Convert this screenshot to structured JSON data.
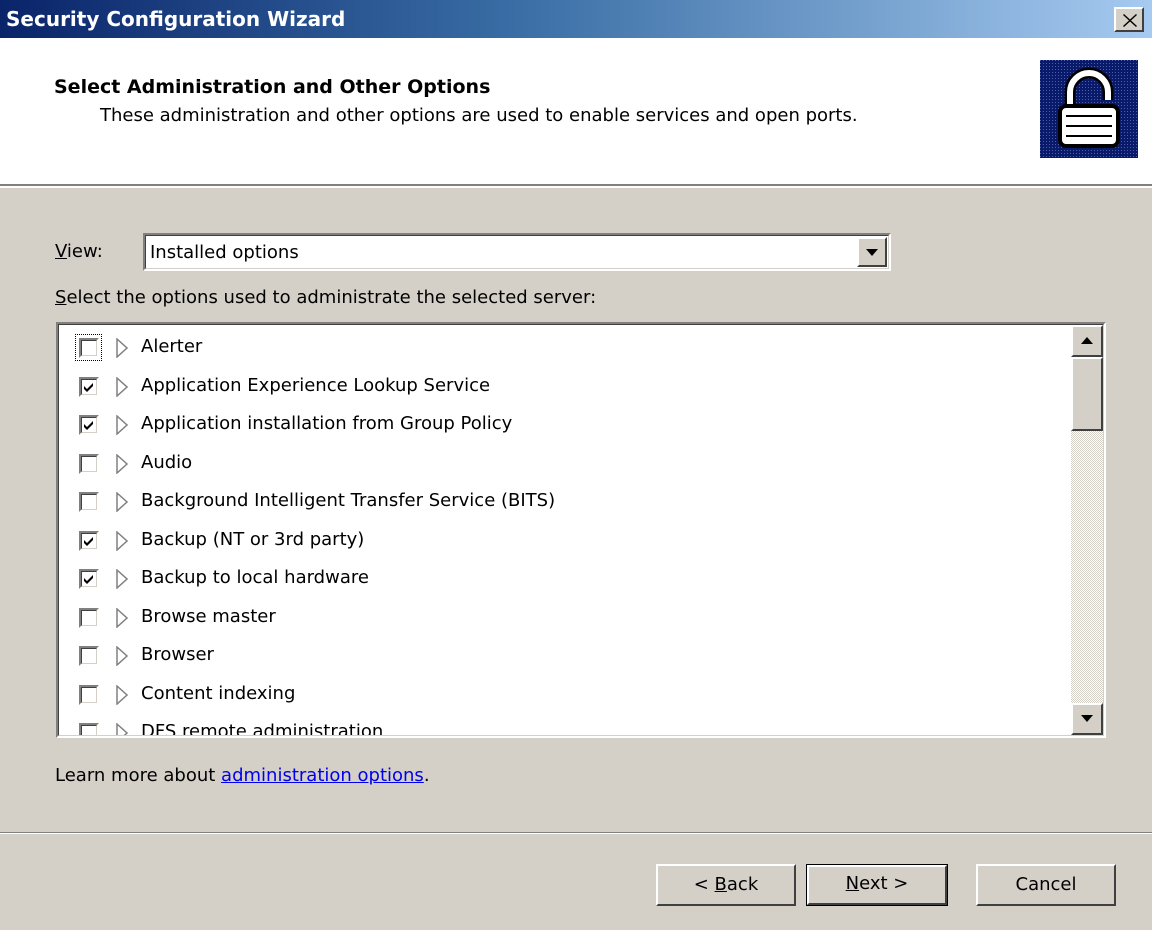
{
  "window": {
    "title": "Security Configuration Wizard",
    "close_label": "X"
  },
  "header": {
    "title": "Select Administration and Other Options",
    "subtitle": "These administration and other options are used to enable services and open ports.",
    "icon": "padlock-icon"
  },
  "view": {
    "label_accel": "V",
    "label_rest": "iew:",
    "value": "Installed options"
  },
  "list": {
    "label_accel": "S",
    "label_rest": "elect the options used to administrate the selected server:",
    "items": [
      {
        "label": "Alerter",
        "checked": false
      },
      {
        "label": "Application Experience Lookup Service",
        "checked": true
      },
      {
        "label": "Application installation from Group Policy",
        "checked": true
      },
      {
        "label": "Audio",
        "checked": false
      },
      {
        "label": "Background Intelligent Transfer Service (BITS)",
        "checked": false
      },
      {
        "label": "Backup (NT or 3rd party)",
        "checked": true
      },
      {
        "label": "Backup to local hardware",
        "checked": true
      },
      {
        "label": "Browse master",
        "checked": false
      },
      {
        "label": "Browser",
        "checked": false
      },
      {
        "label": "Content indexing",
        "checked": false
      },
      {
        "label": "DFS remote administration",
        "checked": false
      }
    ]
  },
  "learn_more": {
    "prefix": "Learn more about ",
    "link": "administration options",
    "suffix": "."
  },
  "buttons": {
    "back_prefix": "< ",
    "back_accel": "B",
    "back_rest": "ack",
    "next_accel": "N",
    "next_rest": "ext >",
    "cancel": "Cancel"
  }
}
